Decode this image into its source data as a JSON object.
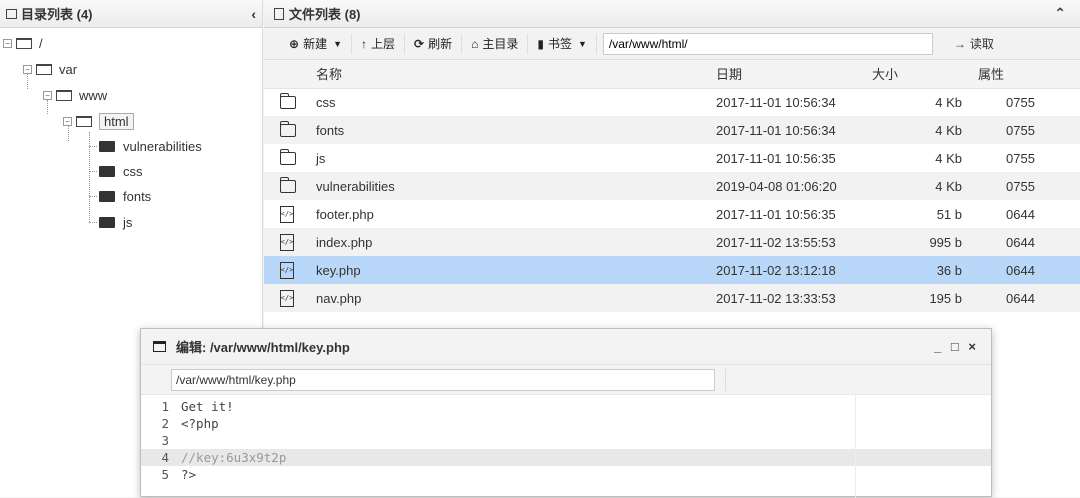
{
  "dir_panel": {
    "title": "目录列表 (4)",
    "collapse": "‹",
    "nodes": [
      "/",
      "var",
      "www",
      "html",
      "vulnerabilities",
      "css",
      "fonts",
      "js"
    ]
  },
  "file_panel": {
    "title": "文件列表 (8)",
    "collapse": "⌃",
    "toolbar": {
      "new_label": "新建",
      "up_label": "上层",
      "refresh_label": "刷新",
      "home_label": "主目录",
      "bookmark_label": "书签",
      "path_value": "/var/www/html/",
      "read_label": "读取"
    },
    "columns": [
      "名称",
      "日期",
      "大小",
      "属性"
    ],
    "rows": [
      {
        "name": "css",
        "date": "2017-11-01 10:56:34",
        "size": "4 Kb",
        "attr": "0755",
        "type": "folder"
      },
      {
        "name": "fonts",
        "date": "2017-11-01 10:56:34",
        "size": "4 Kb",
        "attr": "0755",
        "type": "folder"
      },
      {
        "name": "js",
        "date": "2017-11-01 10:56:35",
        "size": "4 Kb",
        "attr": "0755",
        "type": "folder"
      },
      {
        "name": "vulnerabilities",
        "date": "2019-04-08 01:06:20",
        "size": "4 Kb",
        "attr": "0755",
        "type": "folder"
      },
      {
        "name": "footer.php",
        "date": "2017-11-01 10:56:35",
        "size": "51 b",
        "attr": "0644",
        "type": "file"
      },
      {
        "name": "index.php",
        "date": "2017-11-02 13:55:53",
        "size": "995 b",
        "attr": "0644",
        "type": "file"
      },
      {
        "name": "key.php",
        "date": "2017-11-02 13:12:18",
        "size": "36 b",
        "attr": "0644",
        "type": "file"
      },
      {
        "name": "nav.php",
        "date": "2017-11-02 13:33:53",
        "size": "195 b",
        "attr": "0644",
        "type": "file"
      }
    ]
  },
  "editor": {
    "title": "编辑: /var/www/html/key.php",
    "controls": "_ □ ×",
    "path_value": "/var/www/html/key.php",
    "lines": [
      {
        "n": "1",
        "text": "Get it!"
      },
      {
        "n": "2",
        "text": "<?php"
      },
      {
        "n": "3",
        "text": ""
      },
      {
        "n": "4",
        "text": "//key:6u3x9t2p"
      },
      {
        "n": "5",
        "text": "?>"
      }
    ]
  },
  "colors": {
    "selected_row": "#b9d8f9",
    "panel_header": "#ececec"
  }
}
